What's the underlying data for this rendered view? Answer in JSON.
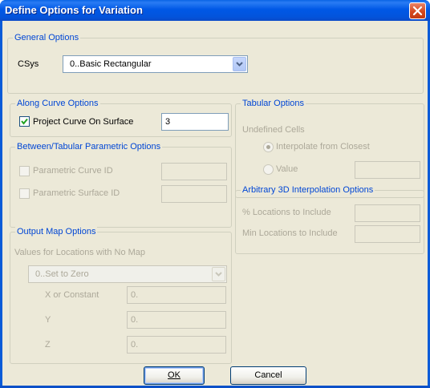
{
  "window": {
    "title": "Define Options for Variation",
    "close_icon": "close-icon"
  },
  "general": {
    "legend": "General Options",
    "csys_label": "CSys",
    "csys_value": "0..Basic Rectangular"
  },
  "along_curve": {
    "legend": "Along Curve Options",
    "project_label": "Project Curve On Surface",
    "project_checked": true,
    "project_value": "3"
  },
  "between_tabular": {
    "legend": "Between/Tabular Parametric Options",
    "curve_id_label": "Parametric Curve ID",
    "curve_id_value": "",
    "surface_id_label": "Parametric Surface ID",
    "surface_id_value": ""
  },
  "output_map": {
    "legend": "Output Map Options",
    "no_map_label": "Values for Locations with No Map",
    "no_map_value": "0..Set to Zero",
    "x_label": "X or Constant",
    "x_value": "0.",
    "y_label": "Y",
    "y_value": "0.",
    "z_label": "Z",
    "z_value": "0."
  },
  "tabular": {
    "legend": "Tabular Options",
    "undefined_cells_label": "Undefined Cells",
    "interpolate_label": "Interpolate from Closest",
    "interpolate_selected": true,
    "value_label": "Value",
    "value_selected": false,
    "value_input": ""
  },
  "arbitrary_3d": {
    "legend": "Arbitrary 3D Interpolation Options",
    "percent_label": "% Locations to Include",
    "percent_value": "",
    "min_label": "Min Locations to Include",
    "min_value": ""
  },
  "buttons": {
    "ok": "OK",
    "cancel": "Cancel"
  }
}
